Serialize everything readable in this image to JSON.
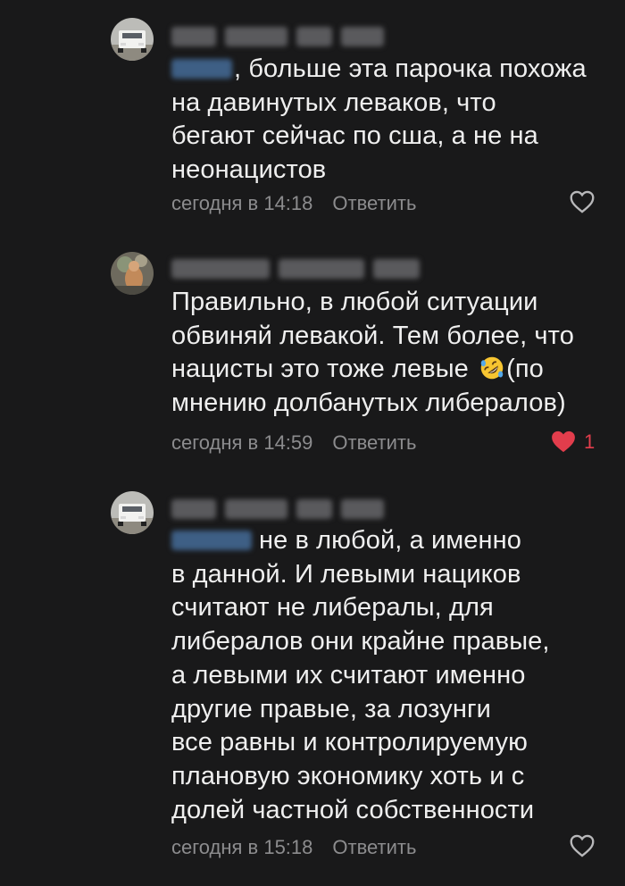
{
  "comments": [
    {
      "lines": [
        ", больше эта парочка похожа",
        "на давинутых леваков, что",
        "бегают сейчас по сша, а не на",
        "неонацистов"
      ],
      "time": "сегодня в 14:18",
      "reply": "Ответить",
      "likes": "",
      "liked": false,
      "emoji": "heart-outline-icon"
    },
    {
      "lines": [
        "Правильно, в любой ситуации",
        "обвиняй левакой. Тем более, что",
        "нацисты это тоже левые ",
        "(по",
        "мнению долбанутых либералов)"
      ],
      "time": "сегодня в 14:59",
      "reply": "Ответить",
      "likes": "1",
      "liked": true,
      "emoji": "rolling-on-floor-laughing-emoji"
    },
    {
      "lines": [
        "не в любой, а именно",
        "в данной. И левыми нациков",
        "считают не либералы, для",
        "либералов они крайне правые,",
        "а левыми их считают именно",
        "другие правые, за лозунги",
        "все равны и контролируемую",
        "плановую экономику хоть и с",
        "долей частной собственности"
      ],
      "time": "сегодня в 15:18",
      "reply": "Ответить",
      "likes": "",
      "liked": false
    }
  ],
  "colors": {
    "background": "#19191a",
    "text": "#efefef",
    "meta": "#8c8c8e",
    "like_active": "#e23d4c"
  }
}
